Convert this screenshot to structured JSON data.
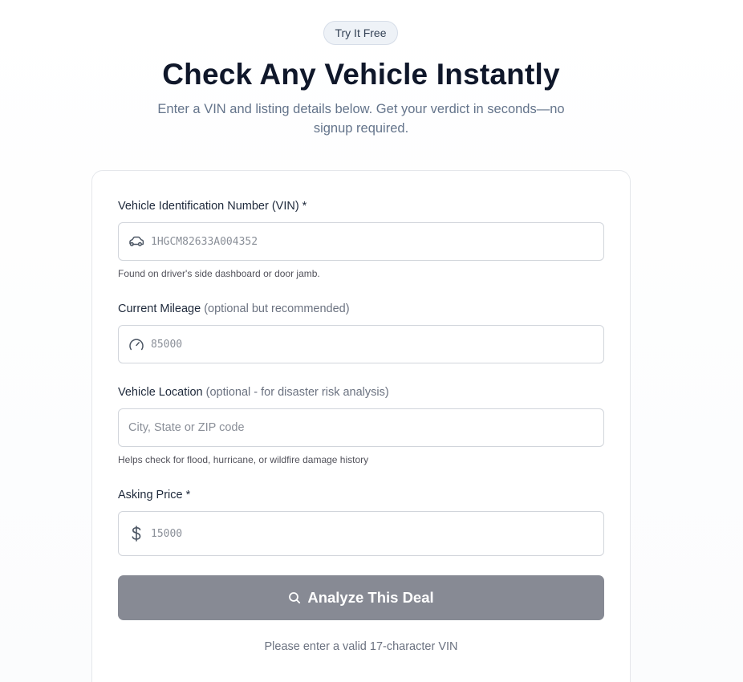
{
  "header": {
    "badge": "Try It Free",
    "title": "Check Any Vehicle Instantly",
    "subtitle": "Enter a VIN and listing details below. Get your verdict in seconds—no signup required."
  },
  "form": {
    "vin": {
      "label": "Vehicle Identification Number (VIN) *",
      "placeholder": "1HGCM82633A004352",
      "value": "",
      "hint": "Found on driver's side dashboard or door jamb.",
      "icon": "car-icon"
    },
    "mileage": {
      "label": "Current Mileage",
      "label_note": "(optional but recommended)",
      "placeholder": "85000",
      "value": "",
      "icon": "gauge-icon"
    },
    "location": {
      "label": "Vehicle Location",
      "label_note": "(optional - for disaster risk analysis)",
      "placeholder": "City, State or ZIP code",
      "value": "",
      "hint": "Helps check for flood, hurricane, or wildfire damage history"
    },
    "price": {
      "label": "Asking Price *",
      "placeholder": "15000",
      "value": "",
      "icon": "dollar-icon"
    },
    "submit": {
      "label": "Analyze This Deal",
      "icon": "search-icon",
      "color": "#878a94"
    },
    "validation_message": "Please enter a valid 17-character VIN"
  }
}
